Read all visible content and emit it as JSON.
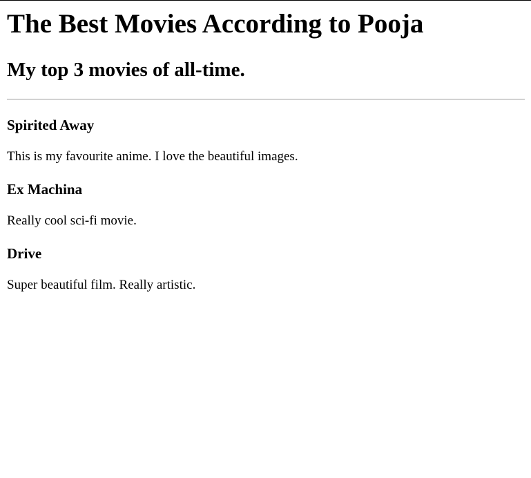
{
  "page": {
    "title": "The Best Movies According to Pooja",
    "subtitle": "My top 3 movies of all-time."
  },
  "movies": [
    {
      "title": "Spirited Away",
      "description": "This is my favourite anime. I love the beautiful images."
    },
    {
      "title": "Ex Machina",
      "description": "Really cool sci-fi movie."
    },
    {
      "title": "Drive",
      "description": "Super beautiful film. Really artistic."
    }
  ]
}
